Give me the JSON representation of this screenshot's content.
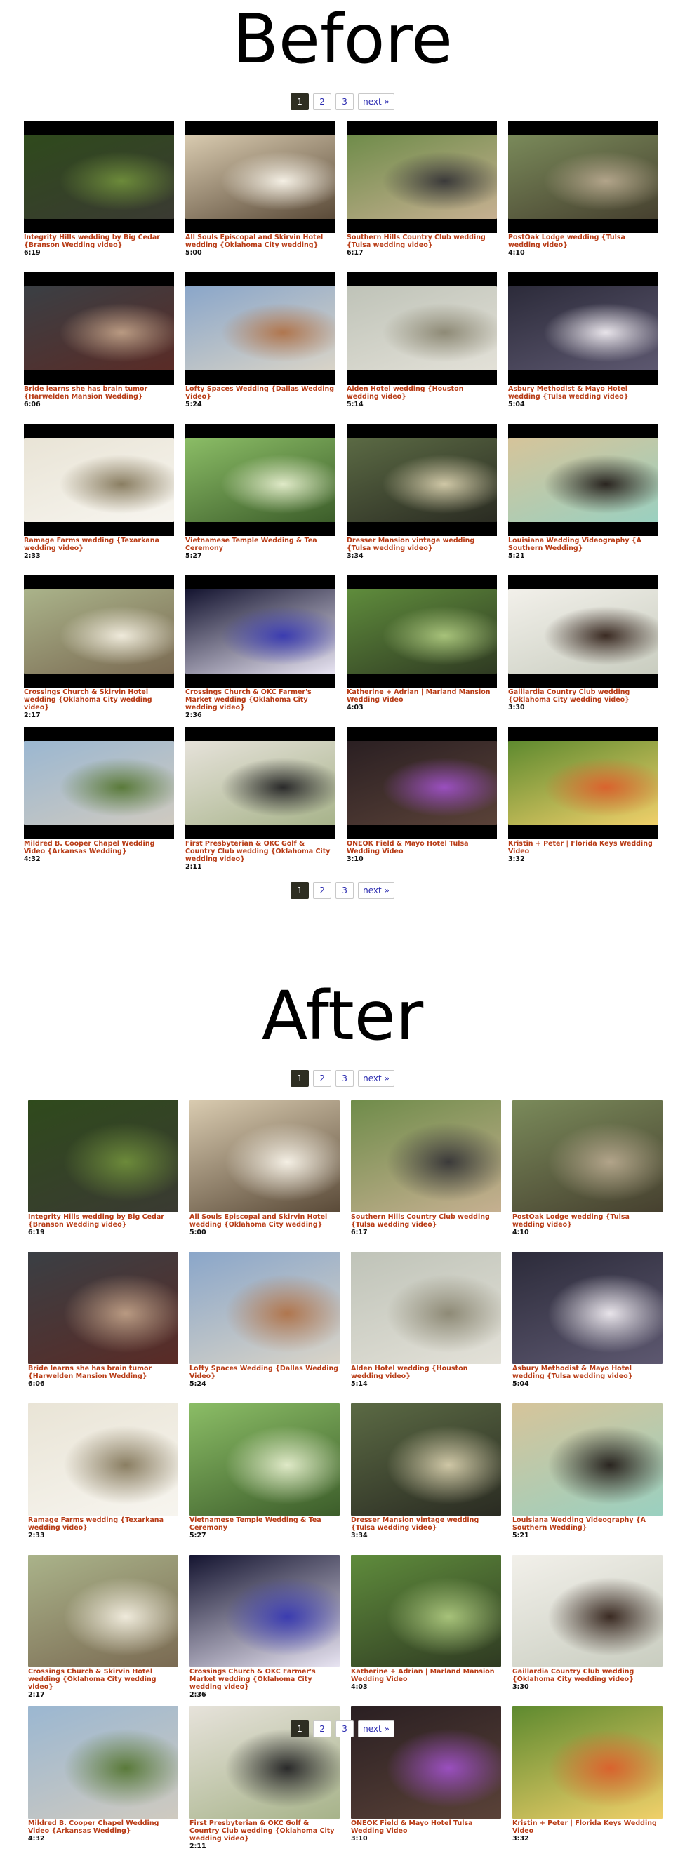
{
  "before": {
    "heading": "Before",
    "pagination": [
      "1",
      "2",
      "3",
      "next »"
    ]
  },
  "after": {
    "heading": "After",
    "pagination": [
      "1",
      "2",
      "3",
      "next »"
    ]
  },
  "videos": [
    {
      "title": "Integrity Hills wedding by Big Cedar {Branson Wedding video}",
      "duration": "6:19",
      "colors": [
        "#2f4a1c",
        "#6c8a3a",
        "#3a3a32"
      ]
    },
    {
      "title": "All Souls Episcopal and Skirvin Hotel wedding {Oklahoma City wedding}",
      "duration": "5:00",
      "colors": [
        "#d9cbb0",
        "#f4efe4",
        "#5a4a38"
      ]
    },
    {
      "title": "Southern Hills Country Club wedding {Tulsa wedding video}",
      "duration": "6:17",
      "colors": [
        "#6f8c4a",
        "#3b3a3a",
        "#c6b091"
      ]
    },
    {
      "title": "PostOak Lodge wedding {Tulsa wedding video}",
      "duration": "4:10",
      "colors": [
        "#7a8a5a",
        "#b2a48a",
        "#46402f"
      ]
    },
    {
      "title": "Bride learns she has brain tumor {Harwelden Mansion Wedding}",
      "duration": "6:06",
      "colors": [
        "#3a3f44",
        "#b99a82",
        "#5a2b26"
      ]
    },
    {
      "title": "Lofty Spaces Wedding {Dallas Wedding Video}",
      "duration": "5:24",
      "colors": [
        "#8aa6c9",
        "#b0764e",
        "#d9d4c8"
      ]
    },
    {
      "title": "Alden Hotel wedding {Houston wedding video}",
      "duration": "5:14",
      "colors": [
        "#bfc3b8",
        "#8e8a76",
        "#e3e1d8"
      ]
    },
    {
      "title": "Asbury Methodist & Mayo Hotel wedding {Tulsa wedding video}",
      "duration": "5:04",
      "colors": [
        "#2c2b3a",
        "#e8e4ea",
        "#5d5870"
      ]
    },
    {
      "title": "Ramage Farms wedding {Texarkana wedding video}",
      "duration": "2:33",
      "colors": [
        "#e9e4d6",
        "#8a7e62",
        "#f7f5ef"
      ]
    },
    {
      "title": "Vietnamese Temple Wedding & Tea Ceremony",
      "duration": "5:27",
      "colors": [
        "#8bbd66",
        "#dfe9c7",
        "#3c5d2a"
      ]
    },
    {
      "title": "Dresser Mansion vintage wedding {Tulsa wedding video}",
      "duration": "3:34",
      "colors": [
        "#5b6a44",
        "#cfc7a6",
        "#2a2b22"
      ]
    },
    {
      "title": "Louisiana Wedding Videography {A Southern Wedding}",
      "duration": "5:21",
      "colors": [
        "#d6c49a",
        "#2a2520",
        "#9ad0c0"
      ]
    },
    {
      "title": "Crossings Church & Skirvin Hotel wedding {Oklahoma City wedding video}",
      "duration": "2:17",
      "colors": [
        "#aab38a",
        "#efeadb",
        "#7a6a52"
      ]
    },
    {
      "title": "Crossings Church & OKC Farmer's Market wedding {Oklahoma City wedding video}",
      "duration": "2:36",
      "colors": [
        "#141430",
        "#3b3cb0",
        "#e8e4f2"
      ]
    },
    {
      "title": "Katherine + Adrian | Marland Mansion Wedding Video",
      "duration": "4:03",
      "colors": [
        "#5f8c3c",
        "#a7c27a",
        "#2f3a22"
      ]
    },
    {
      "title": "Gaillardia Country Club wedding {Oklahoma City wedding video}",
      "duration": "3:30",
      "colors": [
        "#f2f0ea",
        "#3a2a22",
        "#c9cdc0"
      ]
    },
    {
      "title": "Mildred B. Cooper Chapel Wedding Video {Arkansas Wedding}",
      "duration": "4:32",
      "colors": [
        "#9bb7d1",
        "#5a7a3a",
        "#cfcac0"
      ]
    },
    {
      "title": "First Presbyterian & OKC Golf & Country Club wedding {Oklahoma City wedding video}",
      "duration": "2:11",
      "colors": [
        "#e6e2da",
        "#2a2a2a",
        "#a7b38a"
      ]
    },
    {
      "title": "ONEOK Field & Mayo Hotel Tulsa Wedding Video",
      "duration": "3:10",
      "colors": [
        "#2a1f22",
        "#9a4fbf",
        "#5a4238"
      ]
    },
    {
      "title": "Kristin + Peter | Florida Keys Wedding Video",
      "duration": "3:32",
      "colors": [
        "#5e8a2f",
        "#d9632e",
        "#f0d06a"
      ]
    }
  ]
}
